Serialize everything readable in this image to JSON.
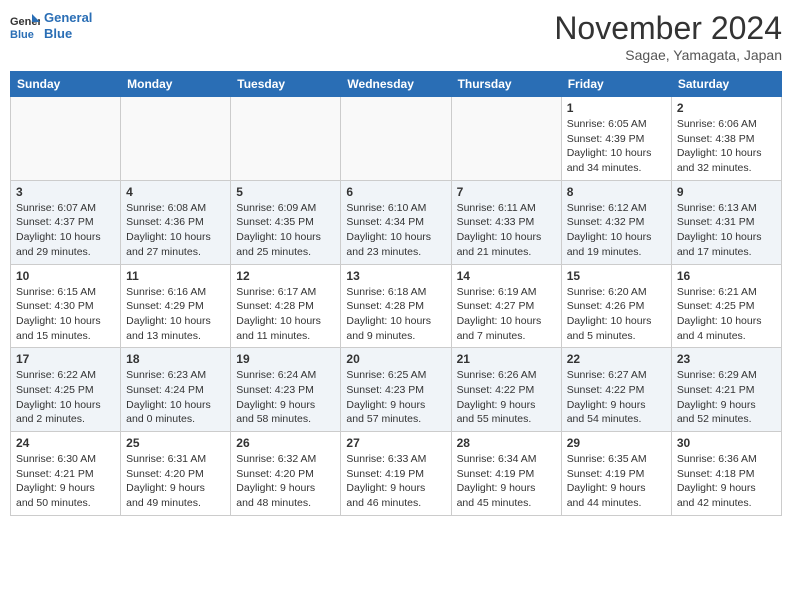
{
  "header": {
    "logo_line1": "General",
    "logo_line2": "Blue",
    "month": "November 2024",
    "location": "Sagae, Yamagata, Japan"
  },
  "weekdays": [
    "Sunday",
    "Monday",
    "Tuesday",
    "Wednesday",
    "Thursday",
    "Friday",
    "Saturday"
  ],
  "weeks": [
    [
      {
        "day": "",
        "info": ""
      },
      {
        "day": "",
        "info": ""
      },
      {
        "day": "",
        "info": ""
      },
      {
        "day": "",
        "info": ""
      },
      {
        "day": "",
        "info": ""
      },
      {
        "day": "1",
        "info": "Sunrise: 6:05 AM\nSunset: 4:39 PM\nDaylight: 10 hours\nand 34 minutes."
      },
      {
        "day": "2",
        "info": "Sunrise: 6:06 AM\nSunset: 4:38 PM\nDaylight: 10 hours\nand 32 minutes."
      }
    ],
    [
      {
        "day": "3",
        "info": "Sunrise: 6:07 AM\nSunset: 4:37 PM\nDaylight: 10 hours\nand 29 minutes."
      },
      {
        "day": "4",
        "info": "Sunrise: 6:08 AM\nSunset: 4:36 PM\nDaylight: 10 hours\nand 27 minutes."
      },
      {
        "day": "5",
        "info": "Sunrise: 6:09 AM\nSunset: 4:35 PM\nDaylight: 10 hours\nand 25 minutes."
      },
      {
        "day": "6",
        "info": "Sunrise: 6:10 AM\nSunset: 4:34 PM\nDaylight: 10 hours\nand 23 minutes."
      },
      {
        "day": "7",
        "info": "Sunrise: 6:11 AM\nSunset: 4:33 PM\nDaylight: 10 hours\nand 21 minutes."
      },
      {
        "day": "8",
        "info": "Sunrise: 6:12 AM\nSunset: 4:32 PM\nDaylight: 10 hours\nand 19 minutes."
      },
      {
        "day": "9",
        "info": "Sunrise: 6:13 AM\nSunset: 4:31 PM\nDaylight: 10 hours\nand 17 minutes."
      }
    ],
    [
      {
        "day": "10",
        "info": "Sunrise: 6:15 AM\nSunset: 4:30 PM\nDaylight: 10 hours\nand 15 minutes."
      },
      {
        "day": "11",
        "info": "Sunrise: 6:16 AM\nSunset: 4:29 PM\nDaylight: 10 hours\nand 13 minutes."
      },
      {
        "day": "12",
        "info": "Sunrise: 6:17 AM\nSunset: 4:28 PM\nDaylight: 10 hours\nand 11 minutes."
      },
      {
        "day": "13",
        "info": "Sunrise: 6:18 AM\nSunset: 4:28 PM\nDaylight: 10 hours\nand 9 minutes."
      },
      {
        "day": "14",
        "info": "Sunrise: 6:19 AM\nSunset: 4:27 PM\nDaylight: 10 hours\nand 7 minutes."
      },
      {
        "day": "15",
        "info": "Sunrise: 6:20 AM\nSunset: 4:26 PM\nDaylight: 10 hours\nand 5 minutes."
      },
      {
        "day": "16",
        "info": "Sunrise: 6:21 AM\nSunset: 4:25 PM\nDaylight: 10 hours\nand 4 minutes."
      }
    ],
    [
      {
        "day": "17",
        "info": "Sunrise: 6:22 AM\nSunset: 4:25 PM\nDaylight: 10 hours\nand 2 minutes."
      },
      {
        "day": "18",
        "info": "Sunrise: 6:23 AM\nSunset: 4:24 PM\nDaylight: 10 hours\nand 0 minutes."
      },
      {
        "day": "19",
        "info": "Sunrise: 6:24 AM\nSunset: 4:23 PM\nDaylight: 9 hours\nand 58 minutes."
      },
      {
        "day": "20",
        "info": "Sunrise: 6:25 AM\nSunset: 4:23 PM\nDaylight: 9 hours\nand 57 minutes."
      },
      {
        "day": "21",
        "info": "Sunrise: 6:26 AM\nSunset: 4:22 PM\nDaylight: 9 hours\nand 55 minutes."
      },
      {
        "day": "22",
        "info": "Sunrise: 6:27 AM\nSunset: 4:22 PM\nDaylight: 9 hours\nand 54 minutes."
      },
      {
        "day": "23",
        "info": "Sunrise: 6:29 AM\nSunset: 4:21 PM\nDaylight: 9 hours\nand 52 minutes."
      }
    ],
    [
      {
        "day": "24",
        "info": "Sunrise: 6:30 AM\nSunset: 4:21 PM\nDaylight: 9 hours\nand 50 minutes."
      },
      {
        "day": "25",
        "info": "Sunrise: 6:31 AM\nSunset: 4:20 PM\nDaylight: 9 hours\nand 49 minutes."
      },
      {
        "day": "26",
        "info": "Sunrise: 6:32 AM\nSunset: 4:20 PM\nDaylight: 9 hours\nand 48 minutes."
      },
      {
        "day": "27",
        "info": "Sunrise: 6:33 AM\nSunset: 4:19 PM\nDaylight: 9 hours\nand 46 minutes."
      },
      {
        "day": "28",
        "info": "Sunrise: 6:34 AM\nSunset: 4:19 PM\nDaylight: 9 hours\nand 45 minutes."
      },
      {
        "day": "29",
        "info": "Sunrise: 6:35 AM\nSunset: 4:19 PM\nDaylight: 9 hours\nand 44 minutes."
      },
      {
        "day": "30",
        "info": "Sunrise: 6:36 AM\nSunset: 4:18 PM\nDaylight: 9 hours\nand 42 minutes."
      }
    ]
  ]
}
